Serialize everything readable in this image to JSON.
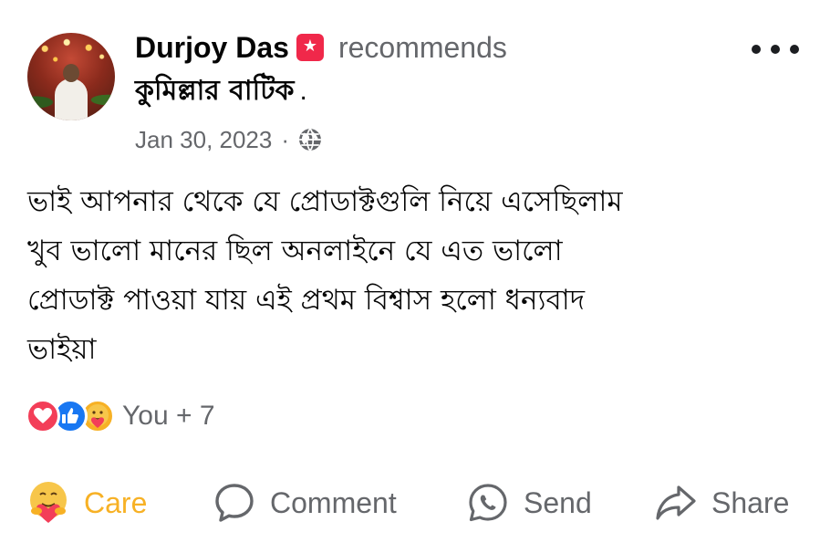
{
  "post": {
    "author": "Durjoy Das",
    "action": "recommends",
    "page_name": "কুমিল্লার বাটিক",
    "page_suffix": ".",
    "date": "Jan 30, 2023",
    "separator": "·",
    "privacy_icon": "globe-icon",
    "more_icon": "more-options-icon",
    "badge_icon": "recommend-badge-icon",
    "body_lines": [
      "ভাই আপনার  থেকে যে প্রোডাক্টগুলি নিয়ে এসেছিলাম",
      "খুব ভালো মানের ছিল অনলাইনে যে এত ভালো",
      "প্রোডাক্ট পাওয়া যায় এই প্রথম বিশ্বাস হলো ধন্যবাদ",
      "ভাইয়া"
    ]
  },
  "reactions": {
    "icons": [
      "love-icon",
      "like-icon",
      "care-icon"
    ],
    "summary": "You + 7"
  },
  "actions": {
    "care": "Care",
    "comment": "Comment",
    "send": "Send",
    "share": "Share"
  },
  "colors": {
    "text_primary": "#050505",
    "text_secondary": "#65676b",
    "care_yellow": "#f7b125",
    "love_red": "#f33e58",
    "like_blue": "#1877f2",
    "badge_red": "#f0284a"
  }
}
